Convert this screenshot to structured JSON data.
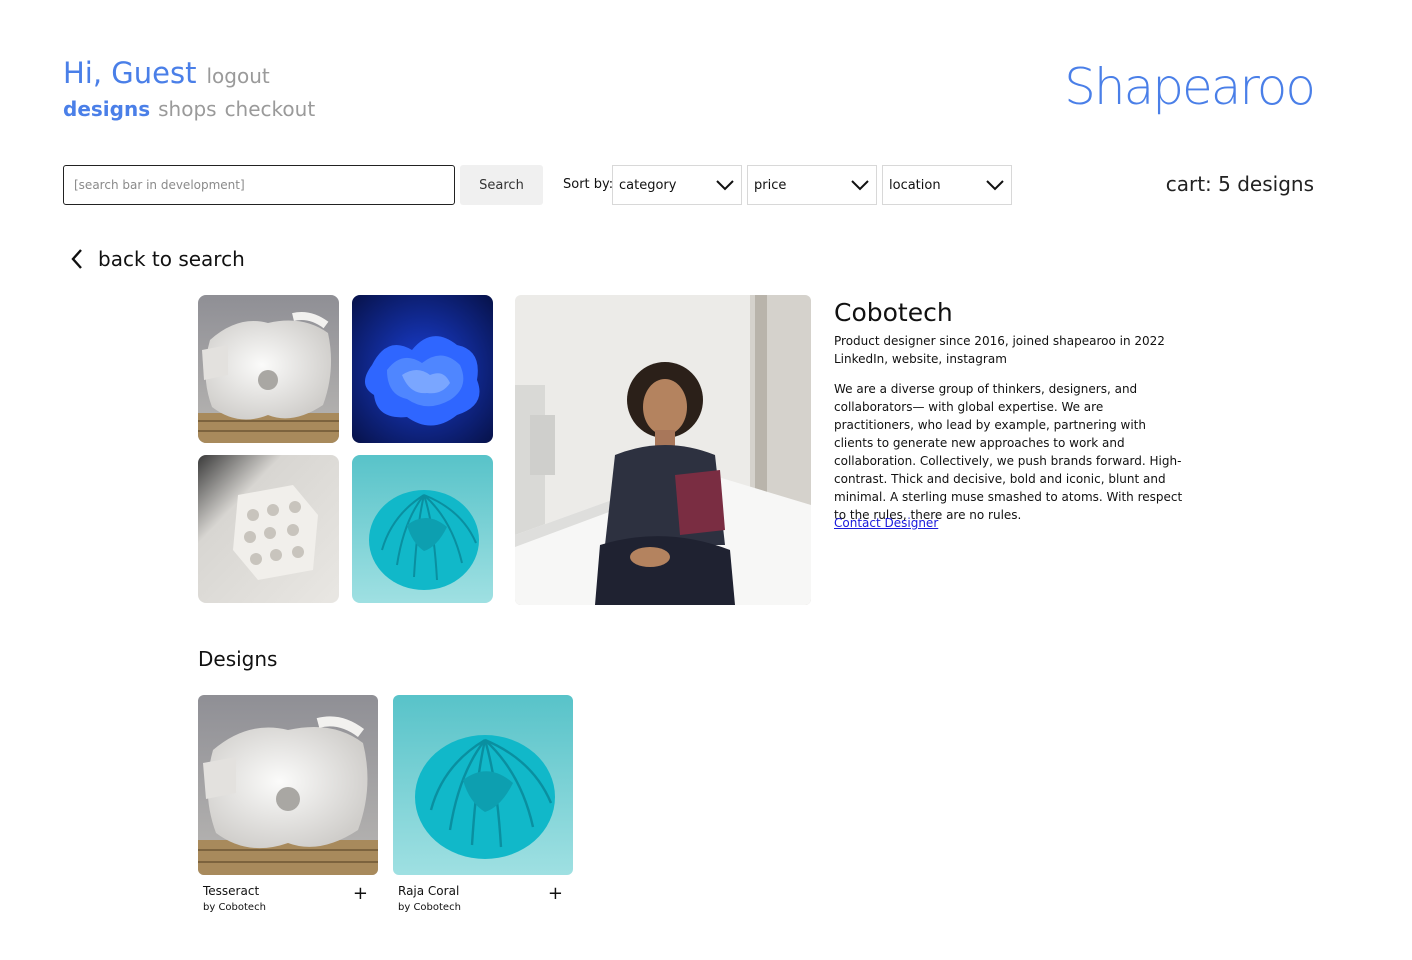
{
  "header": {
    "greeting": "Hi, Guest",
    "logout": "logout",
    "brand": "Shapearoo",
    "nav": [
      "designs",
      "shops",
      "checkout"
    ],
    "cart": "cart: 5 designs"
  },
  "toolbar": {
    "search_placeholder": "[search bar in development]",
    "search_button": "Search",
    "sort_label": "Sort by:",
    "sort_category": "category",
    "sort_price": "price",
    "sort_location": "location"
  },
  "back_link": "back to search",
  "designer": {
    "name": "Cobotech",
    "since": "Product designer since 2016, joined shapearoo in 2022",
    "links": "LinkedIn, website, instagram",
    "bio": "We are a diverse group of thinkers, designers, and collaborators— with global expertise. We are practitioners, who lead by example, partnering with clients to generate new approaches to work and collaboration. Collectively, we push brands forward. High-contrast. Thick and decisive, bold and iconic, blunt and minimal. A sterling muse smashed to atoms. With respect to the rules, there are no rules.",
    "contact": "Contact Designer"
  },
  "designs_section": {
    "title": "Designs",
    "items": [
      {
        "title": "Tesseract",
        "by": "by Cobotech",
        "add": "+"
      },
      {
        "title": "Raja Coral",
        "by": "by Cobotech",
        "add": "+"
      }
    ]
  },
  "colors": {
    "accent": "#4a7fe8",
    "muted": "#9a9a9a",
    "link": "#1a1adb"
  }
}
